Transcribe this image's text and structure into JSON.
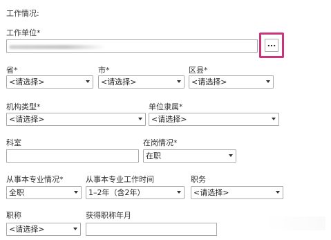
{
  "section_title": "工作情况:",
  "work_unit": {
    "label": "工作单位",
    "button_label": "..."
  },
  "province": {
    "label": "省",
    "value": "<请选择>"
  },
  "city": {
    "label": "市",
    "value": "<请选择>"
  },
  "district": {
    "label": "区县",
    "value": "<请选择>"
  },
  "org_type": {
    "label": "机构类型",
    "value": "<请选择>"
  },
  "affiliation": {
    "label": "单位隶属",
    "value": "<请选择>"
  },
  "department": {
    "label": "科室"
  },
  "job_status": {
    "label": "在岗情况",
    "value": "在职"
  },
  "specialty_status": {
    "label": "从事本专业情况",
    "value": "全职"
  },
  "specialty_duration": {
    "label": "从事本专业工作时间",
    "value": "1–2年（含2年）"
  },
  "position": {
    "label": "职务",
    "value": "<请选择>"
  },
  "title": {
    "label": "职称",
    "value": "<请选择>"
  },
  "title_date": {
    "label": "获得职称年月"
  }
}
